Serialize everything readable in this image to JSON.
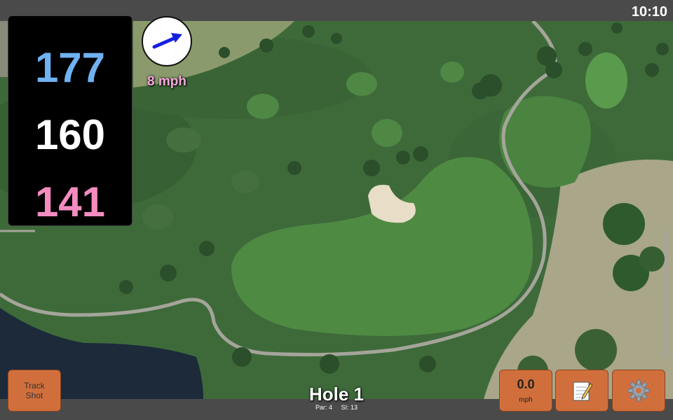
{
  "clock": "10:10",
  "distances": {
    "back": "177",
    "center": "160",
    "front": "141"
  },
  "wind": {
    "speed_label": "8 mph",
    "icon": "wind-direction-arrow-icon"
  },
  "buttons": {
    "track_shot_line1": "Track",
    "track_shot_line2": "Shot",
    "speed_value": "0.0",
    "speed_unit": "mph",
    "notes_icon": "notepad-icon",
    "settings_icon": "gear-icon"
  },
  "hole": {
    "title": "Hole 1",
    "par": "Par: 4",
    "si": "SI: 13"
  },
  "colors": {
    "back_distance": "#6fb2f2",
    "center_distance": "#ffffff",
    "front_distance": "#f48cc0",
    "wind_label": "#f3a8dc",
    "button": "#d16f3c"
  }
}
